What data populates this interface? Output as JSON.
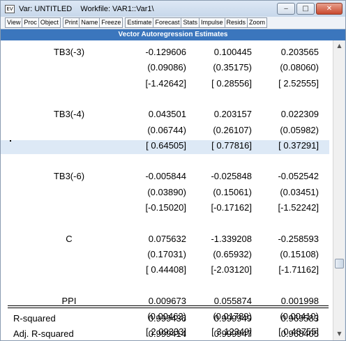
{
  "window": {
    "title": "Var: UNTITLED    Workfile: VAR1::Var1\\",
    "app_icon": "eviews-icon",
    "controls": {
      "minimize": "‒",
      "maximize": "□",
      "close": "✕"
    }
  },
  "toolbar": {
    "groups": [
      [
        "View",
        "Proc",
        "Object"
      ],
      [
        "Print",
        "Name",
        "Freeze"
      ],
      [
        "Estimate",
        "Forecast",
        "Stats",
        "Impulse",
        "Resids",
        "Zoom"
      ]
    ]
  },
  "header": "Vector Autoregression Estimates",
  "table": {
    "rows": [
      [
        "TB3(-3)",
        "-0.129606",
        "0.100445",
        "0.203565"
      ],
      [
        "",
        "(0.09086)",
        "(0.35175)",
        "(0.08060)"
      ],
      [
        "",
        "[-1.42642]",
        "[ 0.28556]",
        "[ 2.52555]"
      ],
      [
        "",
        "",
        "",
        ""
      ],
      [
        "TB3(-4)",
        "0.043501",
        "0.203157",
        "0.022309"
      ],
      [
        "",
        "(0.06744)",
        "(0.26107)",
        "(0.05982)"
      ],
      [
        "",
        "[ 0.64505]",
        "[ 0.77816]",
        "[ 0.37291]"
      ],
      [
        "",
        "",
        "",
        ""
      ],
      [
        "TB3(-6)",
        "-0.005844",
        "-0.025848",
        "-0.052542"
      ],
      [
        "",
        "(0.03890)",
        "(0.15061)",
        "(0.03451)"
      ],
      [
        "",
        "[-0.15020]",
        "[-0.17162]",
        "[-1.52242]"
      ],
      [
        "",
        "",
        "",
        ""
      ],
      [
        "C",
        "0.075632",
        "-1.339208",
        "-0.258593"
      ],
      [
        "",
        "(0.17031)",
        "(0.65932)",
        "(0.15108)"
      ],
      [
        "",
        "[ 0.44408]",
        "[-2.03120]",
        "[-1.71162]"
      ],
      [
        "",
        "",
        "",
        ""
      ],
      [
        "PPI",
        "0.009673",
        "0.055874",
        "0.001998"
      ],
      [
        "",
        "(0.00462)",
        "(0.01789)",
        "(0.00410)"
      ],
      [
        "",
        "[ 2.09333]",
        "[ 3.12349]",
        "[ 0.48755]"
      ]
    ],
    "stats": [
      [
        "R-squared",
        "0.999436",
        "0.999949",
        "0.969583"
      ],
      [
        "Adj. R-squared",
        "0.999414",
        "0.999947",
        "0.968405"
      ]
    ]
  },
  "scrollbar": {
    "up": "▲",
    "down": "▼"
  }
}
